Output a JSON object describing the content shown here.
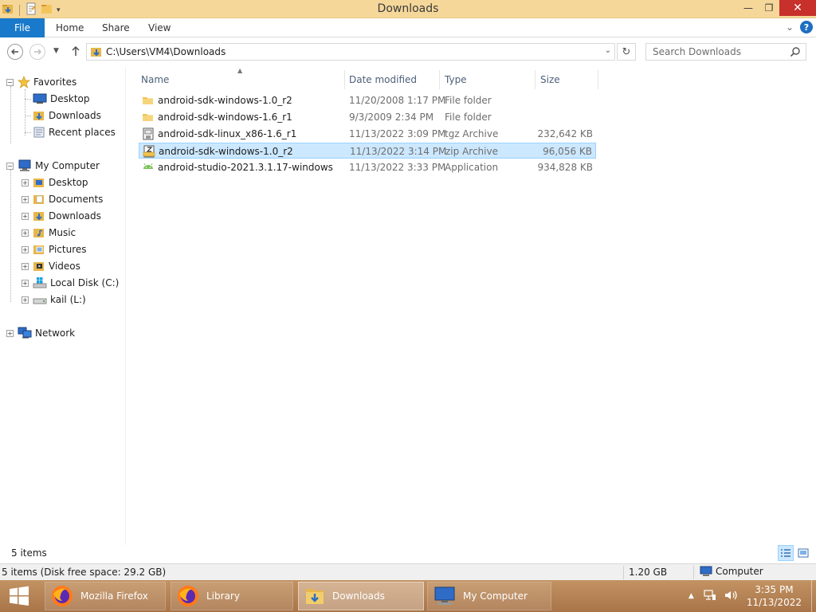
{
  "window": {
    "title": "Downloads",
    "controls": {
      "minimize": "—",
      "maximize": "❐",
      "close": "✕"
    }
  },
  "ribbon": {
    "tabs": [
      {
        "label": "File"
      },
      {
        "label": "Home"
      },
      {
        "label": "Share"
      },
      {
        "label": "View"
      }
    ],
    "expand_glyph": "⌄",
    "help_glyph": "?"
  },
  "address_bar": {
    "path": "C:\\Users\\VM4\\Downloads",
    "search_placeholder": "Search Downloads"
  },
  "nav_pane": {
    "favorites": {
      "label": "Favorites",
      "items": [
        "Desktop",
        "Downloads",
        "Recent places"
      ]
    },
    "computer": {
      "label": "My Computer",
      "items": [
        "Desktop",
        "Documents",
        "Downloads",
        "Music",
        "Pictures",
        "Videos",
        "Local Disk (C:)",
        "kail (L:)"
      ]
    },
    "network": {
      "label": "Network"
    }
  },
  "file_list": {
    "columns": [
      "Name",
      "Date modified",
      "Type",
      "Size"
    ],
    "rows": [
      {
        "name": "android-sdk-windows-1.0_r2",
        "date": "11/20/2008 1:17 PM",
        "type": "File folder",
        "size": "",
        "icon": "folder-icon"
      },
      {
        "name": "android-sdk-windows-1.6_r1",
        "date": "9/3/2009 2:34 PM",
        "type": "File folder",
        "size": "",
        "icon": "folder-icon"
      },
      {
        "name": "android-sdk-linux_x86-1.6_r1",
        "date": "11/13/2022 3:09 PM",
        "type": "tgz Archive",
        "size": "232,642 KB",
        "icon": "archive-icon"
      },
      {
        "name": "android-sdk-windows-1.0_r2",
        "date": "11/13/2022 3:14 PM",
        "type": "zip Archive",
        "size": "96,056 KB",
        "icon": "zip-icon",
        "selected": true
      },
      {
        "name": "android-studio-2021.3.1.17-windows",
        "date": "11/13/2022 3:33 PM",
        "type": "Application",
        "size": "934,828 KB",
        "icon": "android-icon"
      }
    ]
  },
  "status": {
    "item_count": "5 items",
    "disk_info": "5 items (Disk free space: 29.2 GB)",
    "size": "1.20 GB",
    "location": "Computer"
  },
  "taskbar": {
    "items": [
      {
        "label": "Mozilla Firefox",
        "icon": "firefox-icon"
      },
      {
        "label": "Library",
        "icon": "firefox-icon"
      },
      {
        "label": "Downloads",
        "icon": "folder-icon",
        "active": true
      },
      {
        "label": "My Computer",
        "icon": "computer-icon"
      }
    ],
    "tray_arrow": "▲",
    "time": "3:35 PM",
    "date": "11/13/2022"
  },
  "colors": {
    "titlebar": "#f6d79a",
    "file_tab": "#1979ca",
    "selection": "#cce8ff",
    "selection_border": "#99d1ff",
    "close_button": "#c7302b",
    "taskbar": "#b9855a"
  }
}
